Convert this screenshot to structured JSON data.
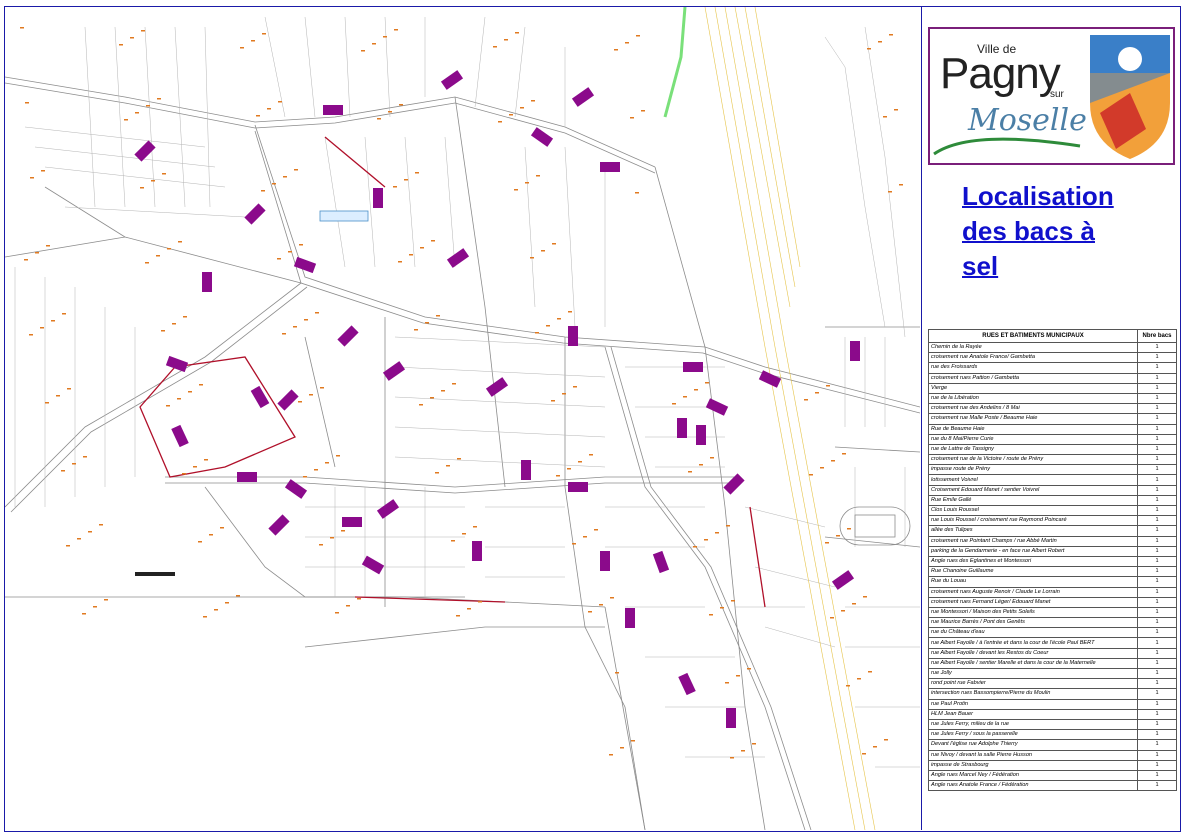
{
  "logo": {
    "ville_de": "Ville de",
    "pagny": "Pagny",
    "sur": "sur",
    "moselle": "Moselle"
  },
  "title": {
    "line1": "Localisation",
    "line2": "des bacs à",
    "line3": "sel"
  },
  "table": {
    "header_street": "RUES ET BATIMENTS MUNICIPAUX",
    "header_count": "Nbre bacs",
    "rows": [
      {
        "street": "Chemin de la Rayée",
        "count": "1"
      },
      {
        "street": "croisement rue Anatole France/ Gambetta",
        "count": "1"
      },
      {
        "street": "rue des Froissards",
        "count": "1"
      },
      {
        "street": "croisement rues Pattion / Gambetta",
        "count": "1"
      },
      {
        "street": "Vierge",
        "count": "1"
      },
      {
        "street": "rue de la Libération",
        "count": "1"
      },
      {
        "street": "croisement rue des Andelins / 8 Mai",
        "count": "1"
      },
      {
        "street": "croisement rue Malle Poste / Beaume Haie",
        "count": "1"
      },
      {
        "street": "Rue de Beaume Haie",
        "count": "1"
      },
      {
        "street": "rue du 8 Mai/Pierre Curie",
        "count": "1"
      },
      {
        "street": "rue de Lattre de Tassigny",
        "count": "1"
      },
      {
        "street": "croisement rue de la Victoire / route de Prény",
        "count": "1"
      },
      {
        "street": "impasse route de Prény",
        "count": "1"
      },
      {
        "street": "lotissement Voivrel",
        "count": "1"
      },
      {
        "street": "Croisement Edouard Manet / sentier Voivrel",
        "count": "1"
      },
      {
        "street": "Rue Emile Gallé",
        "count": "1"
      },
      {
        "street": "Clos Louis Roussel",
        "count": "1"
      },
      {
        "street": "rue Louis Roussel / croisement rue Raymond Poincaré",
        "count": "1"
      },
      {
        "street": "allée des Tulipes",
        "count": "1"
      },
      {
        "street": "croisement rue Pointant Champs / rue Abbé Martin",
        "count": "1"
      },
      {
        "street": "parking de la Gendarmerie - en face rue Albert Robert",
        "count": "1"
      },
      {
        "street": "Angle rues des Eglantines et Montessori",
        "count": "1"
      },
      {
        "street": "Rue Chanoine Guillaume",
        "count": "1"
      },
      {
        "street": "Rue du Louau",
        "count": "1"
      },
      {
        "street": "croisement rues Auguste Renoir / Claude Le Lorrain",
        "count": "1"
      },
      {
        "street": "croisement rues Fernand Léger/ Edouard Manet",
        "count": "1"
      },
      {
        "street": "rue Montessori / Maison des Petits Soleils",
        "count": "1"
      },
      {
        "street": "rue Maurice Barrès / Pont des Genêts",
        "count": "1"
      },
      {
        "street": "rue du Château d'eau",
        "count": "1"
      },
      {
        "street": "rue Albert Fayolle / à l'entrée et dans la cour de l'école Paul BERT",
        "count": "1"
      },
      {
        "street": "rue Albert Fayolle / devant les Restos du Coeur",
        "count": "1"
      },
      {
        "street": "rue Albert Fayolle / sentier Marelle et dans la cour de la Maternelle",
        "count": "1"
      },
      {
        "street": "rue Jolly",
        "count": "1"
      },
      {
        "street": "rond point rue Fabvier",
        "count": "1"
      },
      {
        "street": "intersection rues Bassompierre/Pierre du Moulin",
        "count": "1"
      },
      {
        "street": "rue Paul Protin",
        "count": "1"
      },
      {
        "street": "HLM Jean Bauer",
        "count": "1"
      },
      {
        "street": "rue Jules Ferry, milieu de la rue",
        "count": "1"
      },
      {
        "street": "rue Jules Ferry / sous la passerelle",
        "count": "1"
      },
      {
        "street": "Devant l'église rue Adolphe Thierry",
        "count": "1"
      },
      {
        "street": "rue Nivoy / devant la salle Pierre Husson",
        "count": "1"
      },
      {
        "street": "impasse de Strasbourg",
        "count": "1"
      },
      {
        "street": "Angle rues Marcel Ney / Fédération",
        "count": "1"
      },
      {
        "street": "Angle rues Anatole France / Fédération",
        "count": "1"
      }
    ]
  },
  "map": {
    "marker_color": "#8b0a8b",
    "road_color": "#8c8c8c",
    "label_color": "#e07a20",
    "boundary_color": "#b0102a"
  }
}
